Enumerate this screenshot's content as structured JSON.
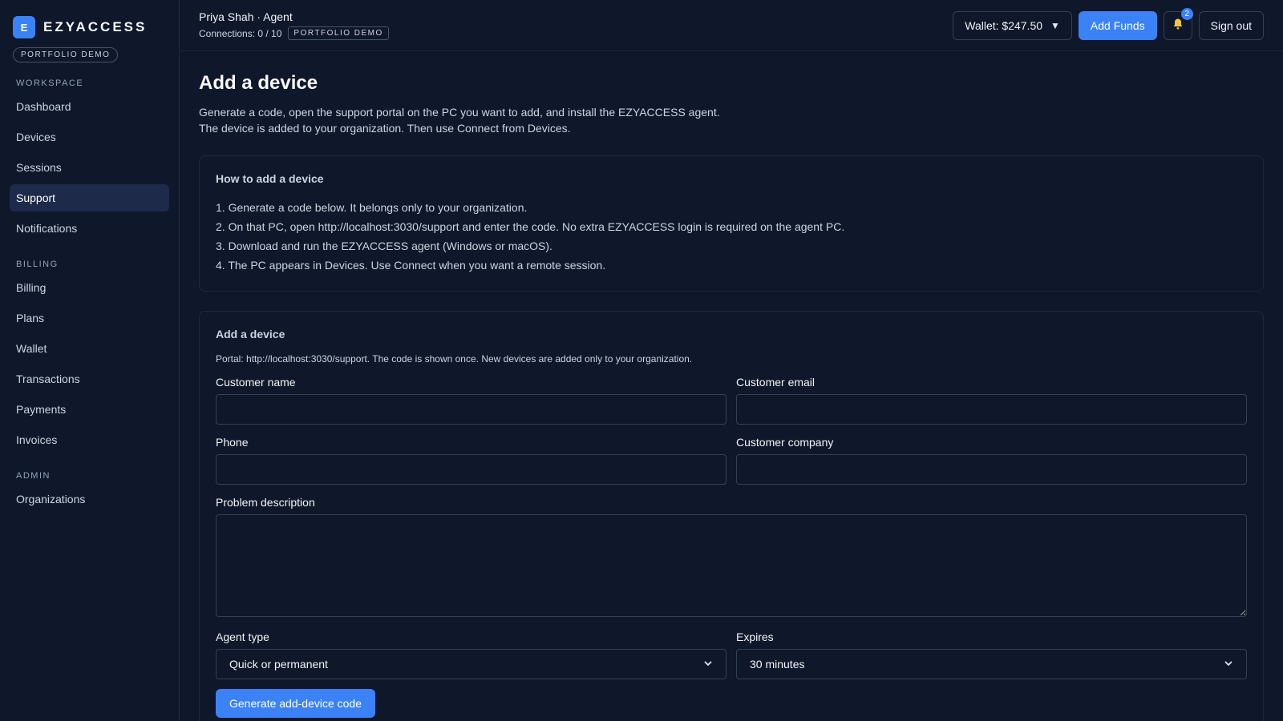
{
  "brand": {
    "logo_letter": "E",
    "name": "EZYACCESS",
    "demo_pill": "PORTFOLIO DEMO"
  },
  "sidebar": {
    "sections": [
      {
        "title": "WORKSPACE",
        "items": [
          "Dashboard",
          "Devices",
          "Sessions",
          "Support",
          "Notifications"
        ]
      },
      {
        "title": "BILLING",
        "items": [
          "Billing",
          "Plans",
          "Wallet",
          "Transactions",
          "Payments",
          "Invoices"
        ]
      },
      {
        "title": "ADMIN",
        "items": [
          "Organizations"
        ]
      }
    ],
    "active_item": "Support"
  },
  "header": {
    "user": "Priya Shah · Agent",
    "connections": "Connections: 0 / 10",
    "demo_tag": "PORTFOLIO DEMO",
    "wallet": "Wallet: $247.50",
    "add_funds": "Add Funds",
    "notification_count": "2",
    "sign_out": "Sign out"
  },
  "page": {
    "title": "Add a device",
    "intro_line1": "Generate a code, open the support portal on the PC you want to add, and install the EZYACCESS agent.",
    "intro_line2": "The device is added to your organization. Then use Connect from Devices."
  },
  "howto": {
    "title": "How to add a device",
    "steps": [
      "1. Generate a code below. It belongs only to your organization.",
      "2. On that PC, open http://localhost:3030/support and enter the code. No extra EZYACCESS login is required on the agent PC.",
      "3. Download and run the EZYACCESS agent (Windows or macOS).",
      "4. The PC appears in Devices. Use Connect when you want a remote session."
    ]
  },
  "form": {
    "title": "Add a device",
    "portal_note": "Portal: http://localhost:3030/support. The code is shown once. New devices are added only to your organization.",
    "labels": {
      "customer_name": "Customer name",
      "customer_email": "Customer email",
      "phone": "Phone",
      "customer_company": "Customer company",
      "problem_description": "Problem description",
      "agent_type": "Agent type",
      "expires": "Expires"
    },
    "values": {
      "agent_type": "Quick or permanent",
      "expires": "30 minutes"
    },
    "submit": "Generate add-device code"
  },
  "colors": {
    "accent": "#3b82f6",
    "background": "#0f172a",
    "border": "#1e293b"
  }
}
